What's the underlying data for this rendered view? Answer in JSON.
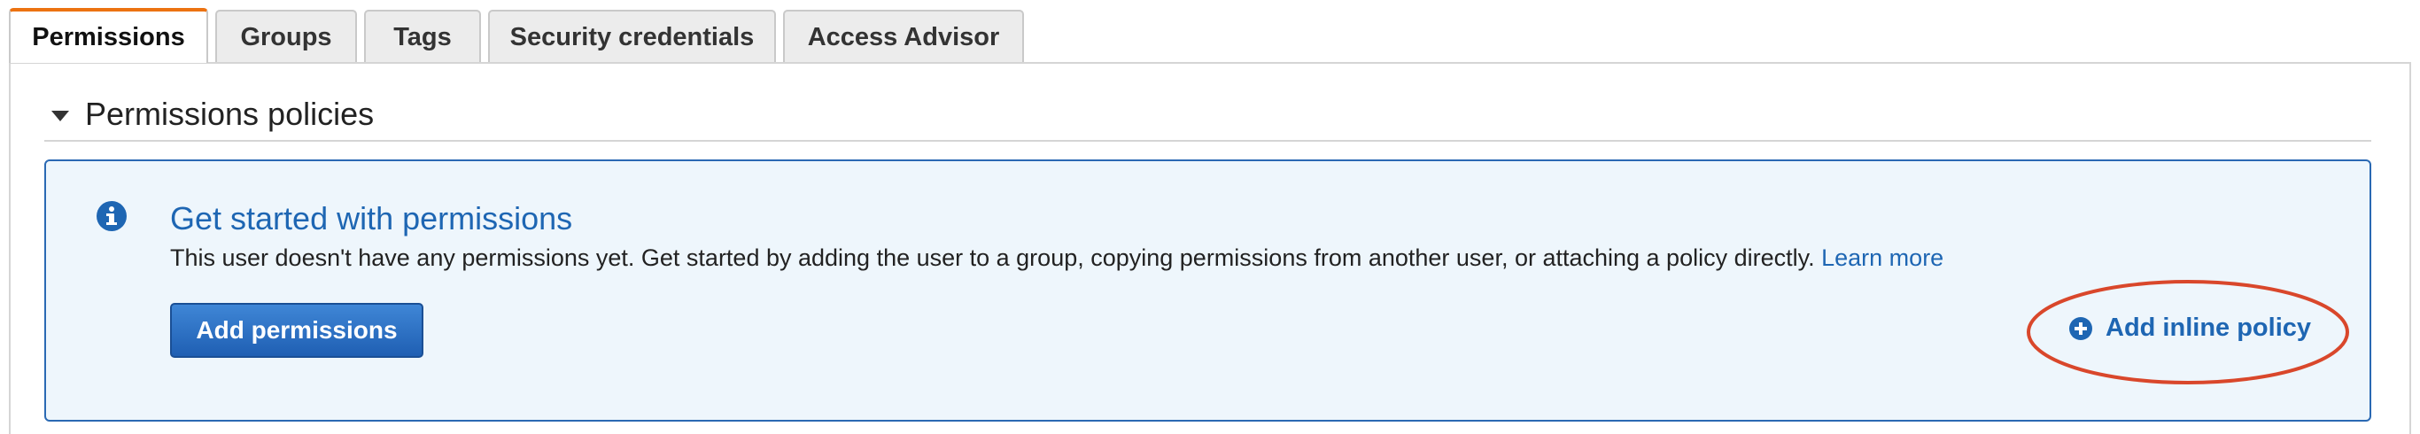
{
  "tabs": [
    {
      "label": "Permissions",
      "active": true
    },
    {
      "label": "Groups",
      "active": false
    },
    {
      "label": "Tags",
      "active": false
    },
    {
      "label": "Security credentials",
      "active": false
    },
    {
      "label": "Access Advisor",
      "active": false
    }
  ],
  "section": {
    "title": "Permissions policies",
    "icon": "caret-down-icon"
  },
  "info_panel": {
    "icon": "info-circle-icon",
    "heading": "Get started with permissions",
    "body": "This user doesn't have any permissions yet. Get started by adding the user to a group, copying permissions from another user, or attaching a policy directly.",
    "learn_more": "Learn more",
    "add_permissions_label": "Add permissions",
    "add_inline_policy_label": "Add inline policy",
    "add_inline_policy_icon": "plus-circle-icon"
  },
  "colors": {
    "accent_tab": "#ec7211",
    "link_blue": "#1e66b3",
    "panel_bg": "#eef6fc",
    "panel_border": "#2a69b3",
    "annotation_red": "#d9472b"
  }
}
